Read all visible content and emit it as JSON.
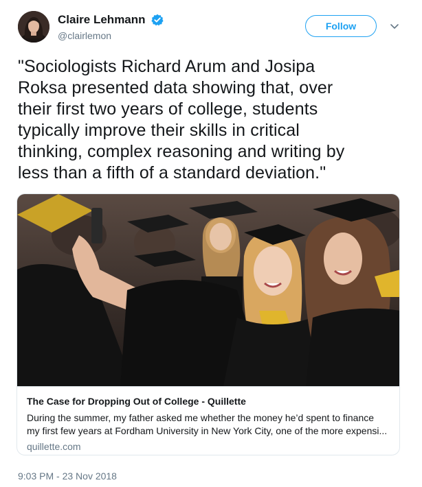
{
  "author": {
    "display_name": "Claire Lehmann",
    "handle": "@clairlemon",
    "verified": true,
    "avatar_icon": "profile-photo"
  },
  "actions": {
    "follow_label": "Follow",
    "menu_icon": "chevron-down-icon"
  },
  "tweet": {
    "text_lines": [
      "\"Sociologists Richard Arum and Josipa",
      "Roksa presented data showing that, over",
      "their first two years of college, students",
      "typically improve their skills in critical",
      "thinking, complex reasoning and writing by",
      "less than a fifth of a standard deviation.\""
    ]
  },
  "card": {
    "image_description_icon": "graduation-selfie-photo",
    "title": "The Case for Dropping Out of College - Quillette",
    "description_lines": [
      "During the summer, my father asked me whether the money he’d spent to finance",
      "my first few years at Fordham University in New York City, one of the more expensi..."
    ],
    "domain": "quillette.com"
  },
  "meta": {
    "timestamp": "9:03 PM - 23 Nov 2018"
  },
  "colors": {
    "accent": "#1da1f2",
    "text": "#14171a",
    "muted": "#657786",
    "border": "#e1e8ed"
  }
}
